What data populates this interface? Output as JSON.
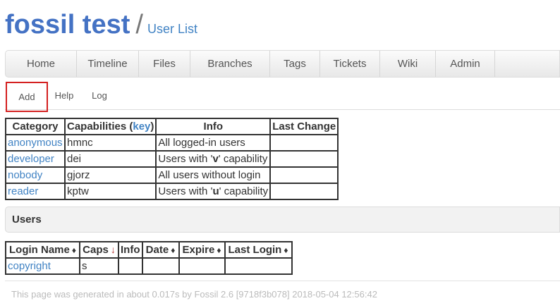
{
  "header": {
    "project": "fossil test",
    "separator": "/",
    "page_title": "User List"
  },
  "mainmenu": [
    "Home",
    "Timeline",
    "Files",
    "Branches",
    "Tags",
    "Tickets",
    "Wiki",
    "Admin"
  ],
  "submenu": [
    "Add",
    "Help",
    "Log"
  ],
  "category_table": {
    "headers": {
      "category": "Category",
      "capabilities_pre": "Capabilities (",
      "capabilities_key": "key",
      "capabilities_post": ")",
      "info": "Info",
      "last_change": "Last Change"
    },
    "rows": [
      {
        "category": "anonymous",
        "caps": "hmnc",
        "info": "All logged-in users",
        "last_change": ""
      },
      {
        "category": "developer",
        "caps": "dei",
        "info_pre": "Users with '",
        "info_bold": "v",
        "info_post": "' capability",
        "last_change": ""
      },
      {
        "category": "nobody",
        "caps": "gjorz",
        "info": "All users without login",
        "last_change": ""
      },
      {
        "category": "reader",
        "caps": "kptw",
        "info_pre": "Users with '",
        "info_bold": "u",
        "info_post": "' capability",
        "last_change": ""
      }
    ]
  },
  "users_panel": {
    "title": "Users"
  },
  "user_table": {
    "headers": [
      "Login Name",
      "Caps",
      "Info",
      "Date",
      "Expire",
      "Last Login"
    ],
    "sort_arrow": "♦",
    "caps_arrow": "↓",
    "rows": [
      {
        "login": "copyright",
        "caps": "s",
        "info": "",
        "date": "",
        "expire": "",
        "last_login": ""
      }
    ]
  },
  "footer": {
    "text": "This page was generated in about 0.017s by Fossil 2.6 [9718f3b078] 2018-05-04 12:56:42"
  }
}
